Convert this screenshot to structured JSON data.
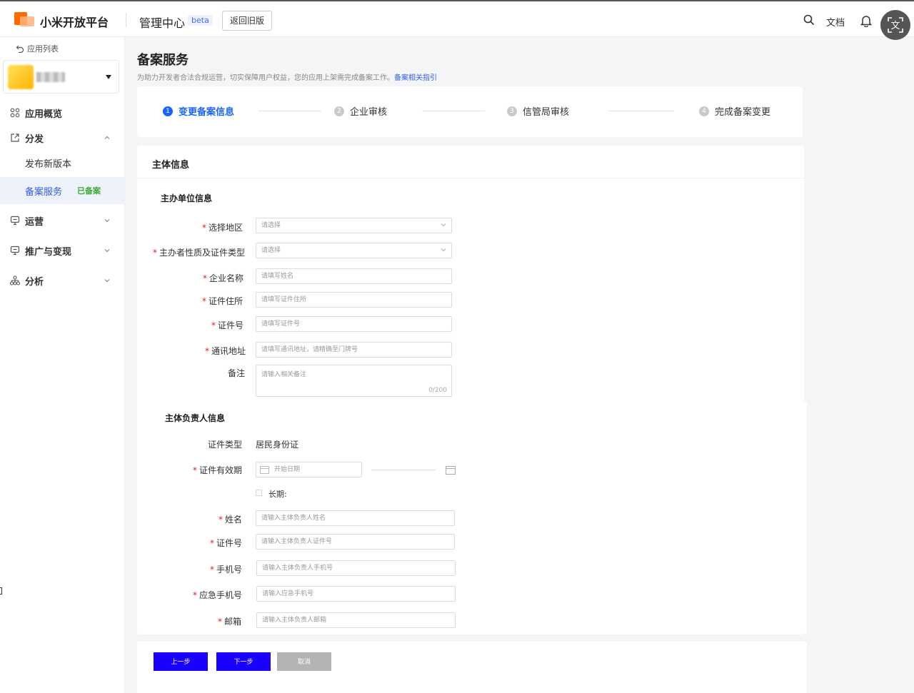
{
  "header": {
    "brand": "小米开放平台",
    "admin_title": "管理中心",
    "beta": "beta",
    "back_old": "返回旧版",
    "docs": "文档"
  },
  "sidebar": {
    "app_list": "应用列表",
    "items": [
      {
        "label": "应用概览",
        "icon": "grid-icon"
      },
      {
        "label": "分发",
        "icon": "share-icon",
        "expanded": true
      },
      {
        "label": "运营",
        "icon": "monitor-icon"
      },
      {
        "label": "推广与变现",
        "icon": "monitor-icon"
      },
      {
        "label": "分析",
        "icon": "hierarchy-icon"
      }
    ],
    "sub_items": [
      {
        "label": "发布新版本"
      },
      {
        "label": "备案服务",
        "tag": "已备案",
        "active": true
      }
    ]
  },
  "page": {
    "title": "备案服务",
    "desc": "为助力开发者合法合规运营，切实保障用户权益，您的应用上架需完成备案工作。",
    "desc_link": "备案相关指引"
  },
  "steps": [
    {
      "num": "1",
      "label": "变更备案信息",
      "active": true
    },
    {
      "num": "2",
      "label": "企业审核"
    },
    {
      "num": "3",
      "label": "信管局审核"
    },
    {
      "num": "4",
      "label": "完成备案变更"
    }
  ],
  "form": {
    "card_title": "主体信息",
    "section1": "主办单位信息",
    "fields1": [
      {
        "label": "选择地区",
        "required": true,
        "placeholder": "请选择"
      },
      {
        "label": "主办者性质及证件类型",
        "required": true,
        "placeholder": "请选择"
      },
      {
        "label": "企业名称",
        "required": true,
        "placeholder": "请填写姓名"
      },
      {
        "label": "证件住所",
        "required": true,
        "placeholder": "请填写证件住所"
      },
      {
        "label": "证件号",
        "required": true,
        "placeholder": "请填写证件号"
      },
      {
        "label": "通讯地址",
        "required": true,
        "placeholder": "请填写通讯地址，请精确至门牌号"
      },
      {
        "label": "备注",
        "required": false,
        "placeholder": "请输入相关备注",
        "count": "0/200"
      }
    ],
    "section2": "主体负责人信息",
    "cert_type_label": "证件类型",
    "cert_type_value": "居民身份证",
    "validity_label": "证件有效期",
    "start_date": "开始日期",
    "long_term": "长期:",
    "fields2": [
      {
        "label": "姓名",
        "placeholder": "请输入主体负责人姓名"
      },
      {
        "label": "证件号",
        "placeholder": "请输入主体负责人证件号"
      },
      {
        "label": "手机号",
        "placeholder": "请输入主体负责人手机号"
      },
      {
        "label": "应急手机号",
        "placeholder": "请输入应急手机号"
      },
      {
        "label": "邮箱",
        "placeholder": "请输入主体负责人邮箱"
      }
    ]
  },
  "buttons": {
    "prev": "上一步",
    "next": "下一步",
    "cancel": "取消"
  },
  "colors": {
    "accent": "#1764ff",
    "link": "#2d5cf6",
    "required": "#e02020",
    "tag_green": "#3aa935",
    "button_primary": "#1a00ff"
  }
}
